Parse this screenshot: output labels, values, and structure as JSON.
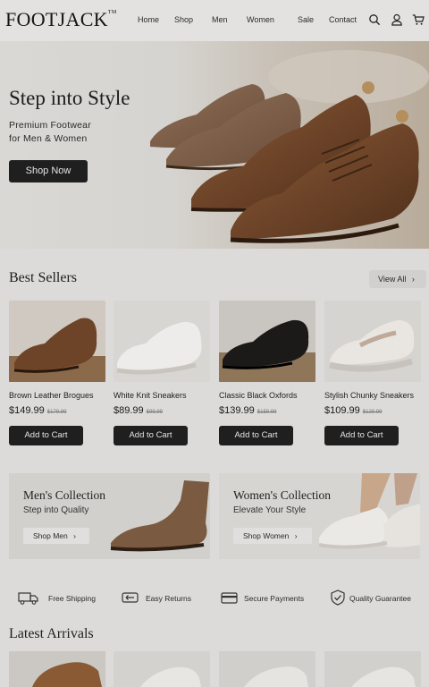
{
  "brand": {
    "logo": "FOOTJACK",
    "trademark": "TM"
  },
  "nav": {
    "items": [
      "Home",
      "Shop",
      "Men",
      "Women",
      "Sale",
      "Contact"
    ]
  },
  "header_icons": [
    "search-icon",
    "user-icon",
    "cart-icon"
  ],
  "hero": {
    "title": "Step into Style",
    "subtitle_line1": "Premium Footwear",
    "subtitle_line2": "for Men & Women",
    "cta": "Shop Now"
  },
  "best_sellers": {
    "title": "Best Sellers",
    "view_all": "View All",
    "products": [
      {
        "name": "Brown Leather Brogues",
        "price": "$149.99",
        "old_price": "$179.99",
        "cta": "Add to Cart"
      },
      {
        "name": "White Knit Sneakers",
        "price": "$89.99",
        "old_price": "$99.99",
        "cta": "Add to Cart"
      },
      {
        "name": "Classic Black Oxfords",
        "price": "$139.99",
        "old_price": "$159.99",
        "cta": "Add to Cart"
      },
      {
        "name": "Stylish Chunky Sneakers",
        "price": "$109.99",
        "old_price": "$129.99",
        "cta": "Add to Cart"
      }
    ]
  },
  "collections": {
    "men": {
      "title": "Men's Collection",
      "subtitle": "Step into Quality",
      "cta": "Shop Men"
    },
    "women": {
      "title": "Women's Collection",
      "subtitle": "Elevate Your Style",
      "cta": "Shop Women"
    }
  },
  "features": [
    {
      "label": "Free Shipping",
      "icon": "truck-icon"
    },
    {
      "label": "Easy Returns",
      "icon": "returns-icon"
    },
    {
      "label": "Secure Payments",
      "icon": "card-icon"
    },
    {
      "label": "Quality Guarantee",
      "icon": "shield-check-icon"
    }
  ],
  "latest": {
    "title": "Latest Arrivals"
  },
  "colors": {
    "dark_button": "#1f1f1f",
    "page_bg": "#dcdbd9",
    "leather_brown": "#6e4428"
  }
}
